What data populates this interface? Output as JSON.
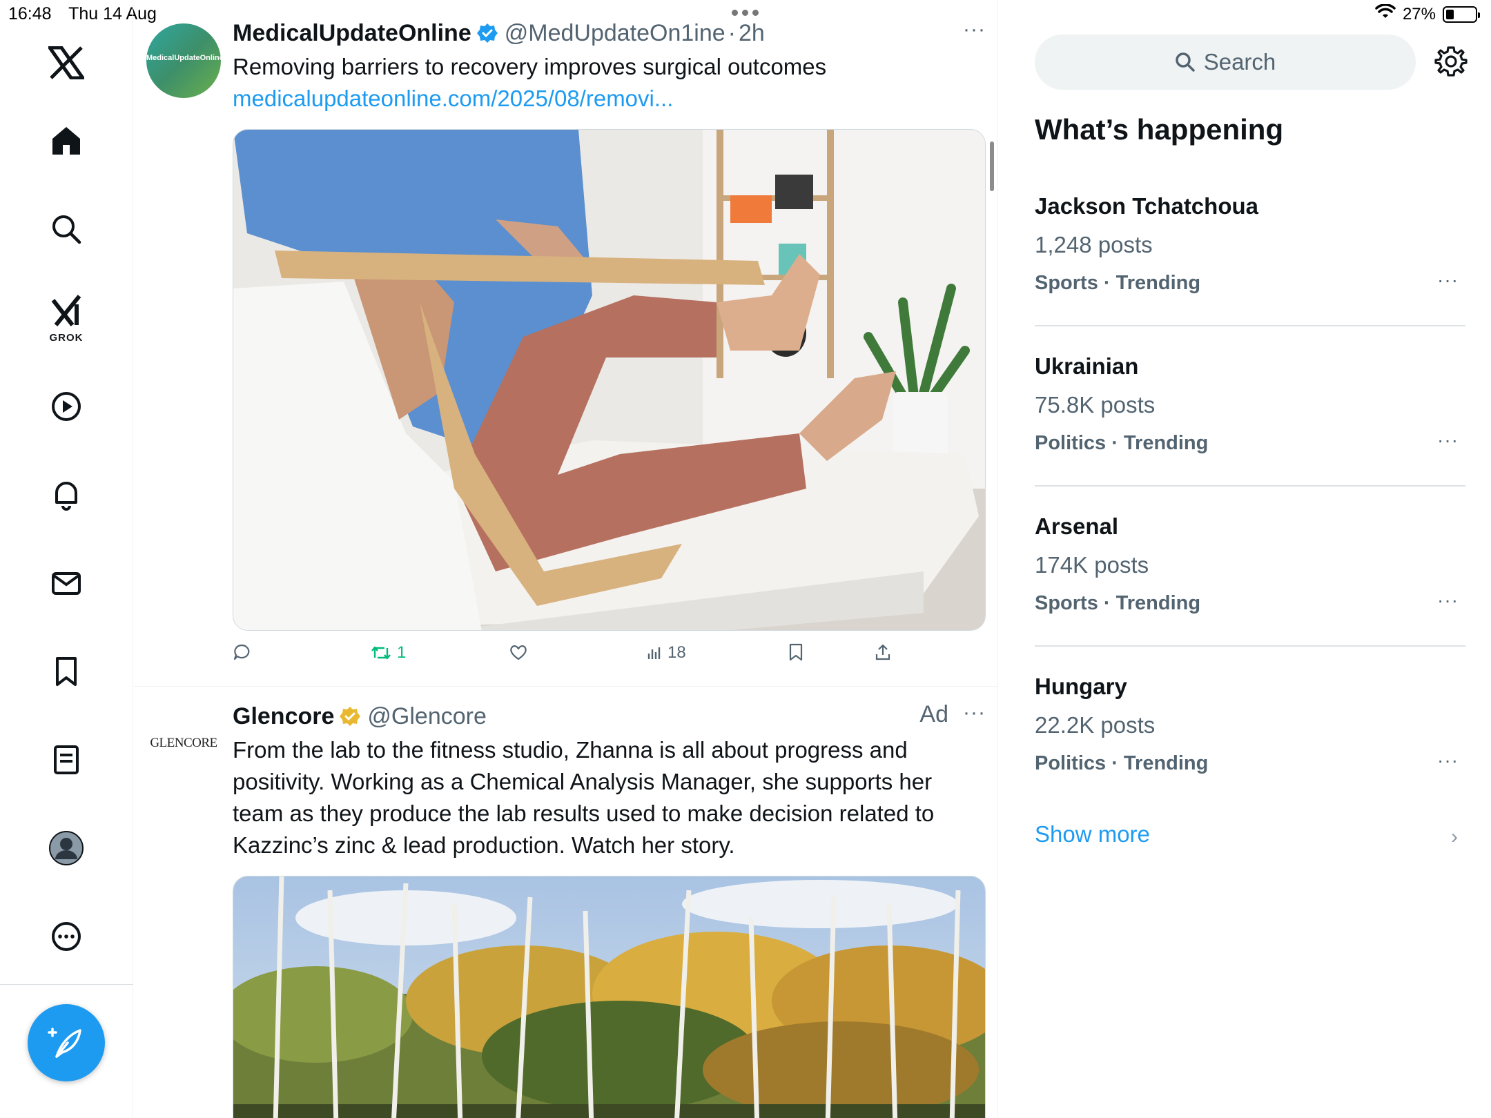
{
  "status_bar": {
    "time": "16:48",
    "date": "Thu 14 Aug",
    "battery": "27%",
    "battery_level": 0.27
  },
  "nav": {
    "items": [
      "x-logo",
      "home",
      "explore",
      "grok",
      "video",
      "notifications",
      "messages",
      "bookmarks",
      "lists",
      "profile",
      "more"
    ],
    "grok_label": "GROK",
    "accent": "#1d9bf0"
  },
  "timeline": {
    "tweets": [
      {
        "avatar_text": "MedicalUpdateOnline",
        "name": "MedicalUpdateOnline",
        "verified": "blue",
        "handle": "@MedUpdateOn1ine",
        "time": "2h",
        "text": "Removing barriers to recovery improves surgical outcomes",
        "link": "medicalupdateonline.com/2025/08/removi...",
        "actions": {
          "replies": "",
          "retweets": "1",
          "likes": "",
          "views": "18"
        },
        "more": "···"
      },
      {
        "avatar_text": "GLENCORE",
        "name": "Glencore",
        "verified": "gold",
        "handle": "@Glencore",
        "ad_label": "Ad",
        "text": "From the lab to the fitness studio, Zhanna is all about progress and positivity.  Working as a Chemical Analysis Manager, she supports her team as they produce the lab results used to make decision related to Kazzinc’s zinc & lead production. Watch her story.",
        "more": "···"
      }
    ]
  },
  "right": {
    "search_placeholder": "Search",
    "section_title": "What’s happening",
    "trends": [
      {
        "name": "Jackson Tchatchoua",
        "posts": "1,248 posts",
        "category": "Sports · Trending"
      },
      {
        "name": "Ukrainian",
        "posts": "75.8K posts",
        "category": "Politics · Trending"
      },
      {
        "name": "Arsenal",
        "posts": "174K posts",
        "category": "Sports · Trending"
      },
      {
        "name": "Hungary",
        "posts": "22.2K posts",
        "category": "Politics · Trending"
      }
    ],
    "trend_more": "···",
    "show_more": "Show more",
    "chevron": "›"
  }
}
